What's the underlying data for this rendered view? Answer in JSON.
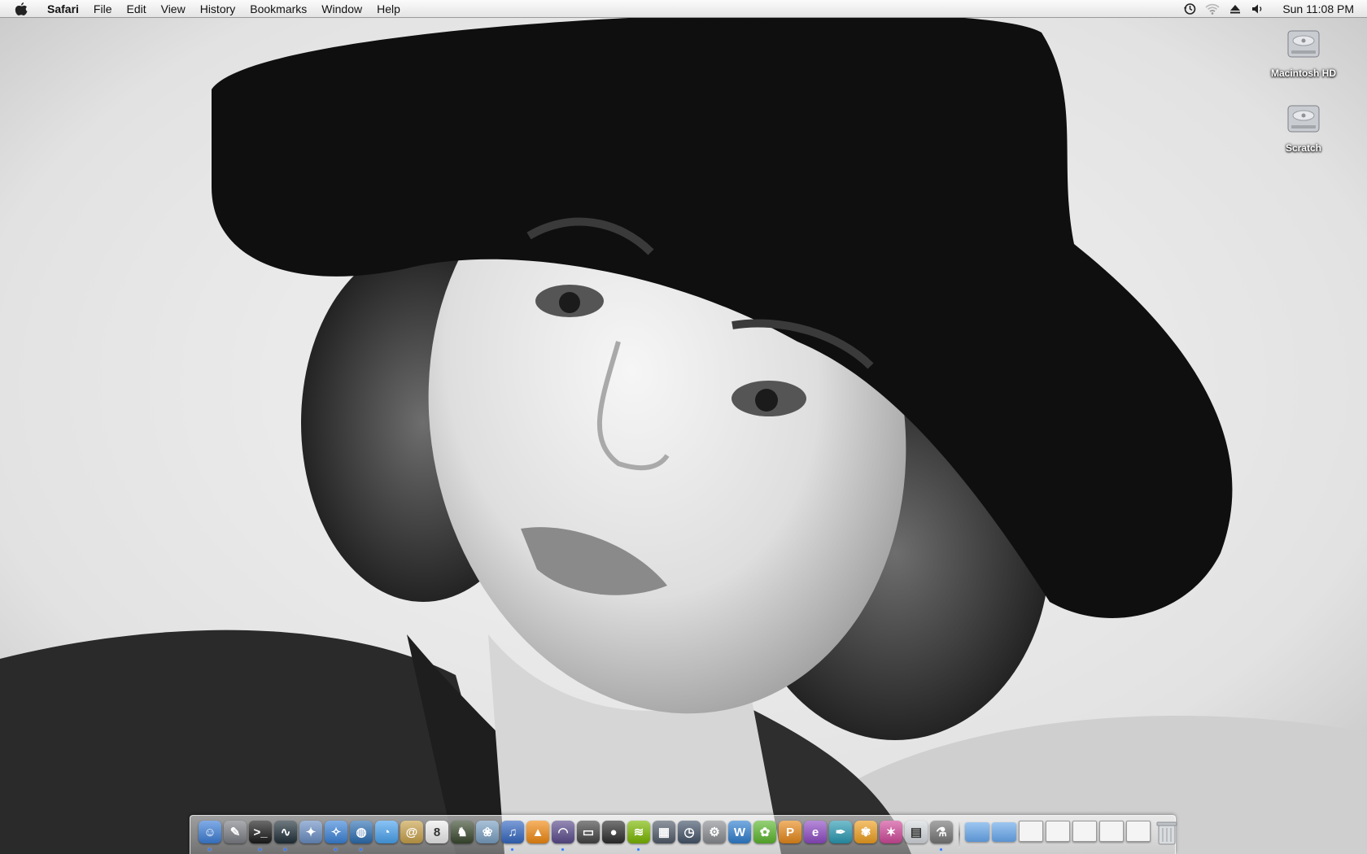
{
  "menubar": {
    "apple_icon": "apple-logo-icon",
    "app_name": "Safari",
    "menus": [
      "File",
      "Edit",
      "View",
      "History",
      "Bookmarks",
      "Window",
      "Help"
    ],
    "status_icons": [
      "time-machine-icon",
      "wifi-icon",
      "eject-icon",
      "volume-icon"
    ],
    "clock": "Sun 11:08 PM"
  },
  "desktop": {
    "icons": [
      {
        "label": "Macintosh HD",
        "icon": "hard-drive-icon"
      },
      {
        "label": "Scratch",
        "icon": "hard-drive-icon"
      }
    ]
  },
  "dock": {
    "apps": [
      {
        "name": "finder-icon",
        "color": "#3d7fd8",
        "glyph": "☺",
        "running": true
      },
      {
        "name": "xcode-tools-icon",
        "color": "#7c7f86",
        "glyph": "✎",
        "running": false
      },
      {
        "name": "terminal-icon",
        "color": "#1a1a1a",
        "glyph": ">_",
        "running": true
      },
      {
        "name": "activity-monitor-icon",
        "color": "#20303a",
        "glyph": "∿",
        "running": true
      },
      {
        "name": "preview-icon",
        "color": "#6b8fc4",
        "glyph": "✦",
        "running": false
      },
      {
        "name": "safari-icon",
        "color": "#3b83d9",
        "glyph": "✧",
        "running": true
      },
      {
        "name": "browser-globe-icon",
        "color": "#2d6fb3",
        "glyph": "◍",
        "running": true
      },
      {
        "name": "ichat-icon",
        "color": "#4aa3f0",
        "glyph": "◔",
        "running": false
      },
      {
        "name": "mail-icon",
        "color": "#c9a24a",
        "glyph": "@",
        "running": false
      },
      {
        "name": "ical-icon",
        "color": "#eeeeee",
        "glyph": "8",
        "running": false
      },
      {
        "name": "game-character-icon",
        "color": "#3b4a2f",
        "glyph": "♞",
        "running": false
      },
      {
        "name": "iphoto-icon",
        "color": "#7aa0c4",
        "glyph": "❀",
        "running": false
      },
      {
        "name": "itunes-icon",
        "color": "#3468c2",
        "glyph": "♫",
        "running": true
      },
      {
        "name": "vlc-icon",
        "color": "#f28a12",
        "glyph": "▲",
        "running": false
      },
      {
        "name": "network-meter-icon",
        "color": "#5a4b8c",
        "glyph": "◠",
        "running": true
      },
      {
        "name": "front-row-icon",
        "color": "#444444",
        "glyph": "▭",
        "running": false
      },
      {
        "name": "xbmc-icon",
        "color": "#2c2c2c",
        "glyph": "●",
        "running": false
      },
      {
        "name": "spotify-icon",
        "color": "#7ab800",
        "glyph": "≋",
        "running": true
      },
      {
        "name": "dashboard-icon",
        "color": "#525c6b",
        "glyph": "▦",
        "running": false
      },
      {
        "name": "time-machine-app-icon",
        "color": "#44556a",
        "glyph": "◷",
        "running": false
      },
      {
        "name": "system-preferences-icon",
        "color": "#8a8d92",
        "glyph": "⚙",
        "running": false
      },
      {
        "name": "writer-icon",
        "color": "#2f7fd0",
        "glyph": "W",
        "running": false
      },
      {
        "name": "plant-app-icon",
        "color": "#5cb82e",
        "glyph": "✿",
        "running": false
      },
      {
        "name": "pages-app-icon",
        "color": "#e88a1a",
        "glyph": "P",
        "running": false
      },
      {
        "name": "editor-app-icon",
        "color": "#8e4bc4",
        "glyph": "e",
        "running": false
      },
      {
        "name": "quill-app-icon",
        "color": "#2a9ab3",
        "glyph": "✒",
        "running": false
      },
      {
        "name": "flower-app-icon",
        "color": "#f0a020",
        "glyph": "✾",
        "running": false
      },
      {
        "name": "photo-app-icon",
        "color": "#d04a9a",
        "glyph": "✶",
        "running": false
      },
      {
        "name": "spreadsheet-app-icon",
        "color": "#d7dbe0",
        "glyph": "▤",
        "running": false
      },
      {
        "name": "automator-icon",
        "color": "#777777",
        "glyph": "⚗",
        "running": true
      }
    ],
    "stack_tiles": [
      "folder",
      "folder",
      "doc",
      "doc",
      "doc",
      "doc",
      "doc"
    ]
  },
  "colors": {
    "dock_running_dot": "#3a78ff",
    "desktop_label_text": "#ffffff"
  }
}
